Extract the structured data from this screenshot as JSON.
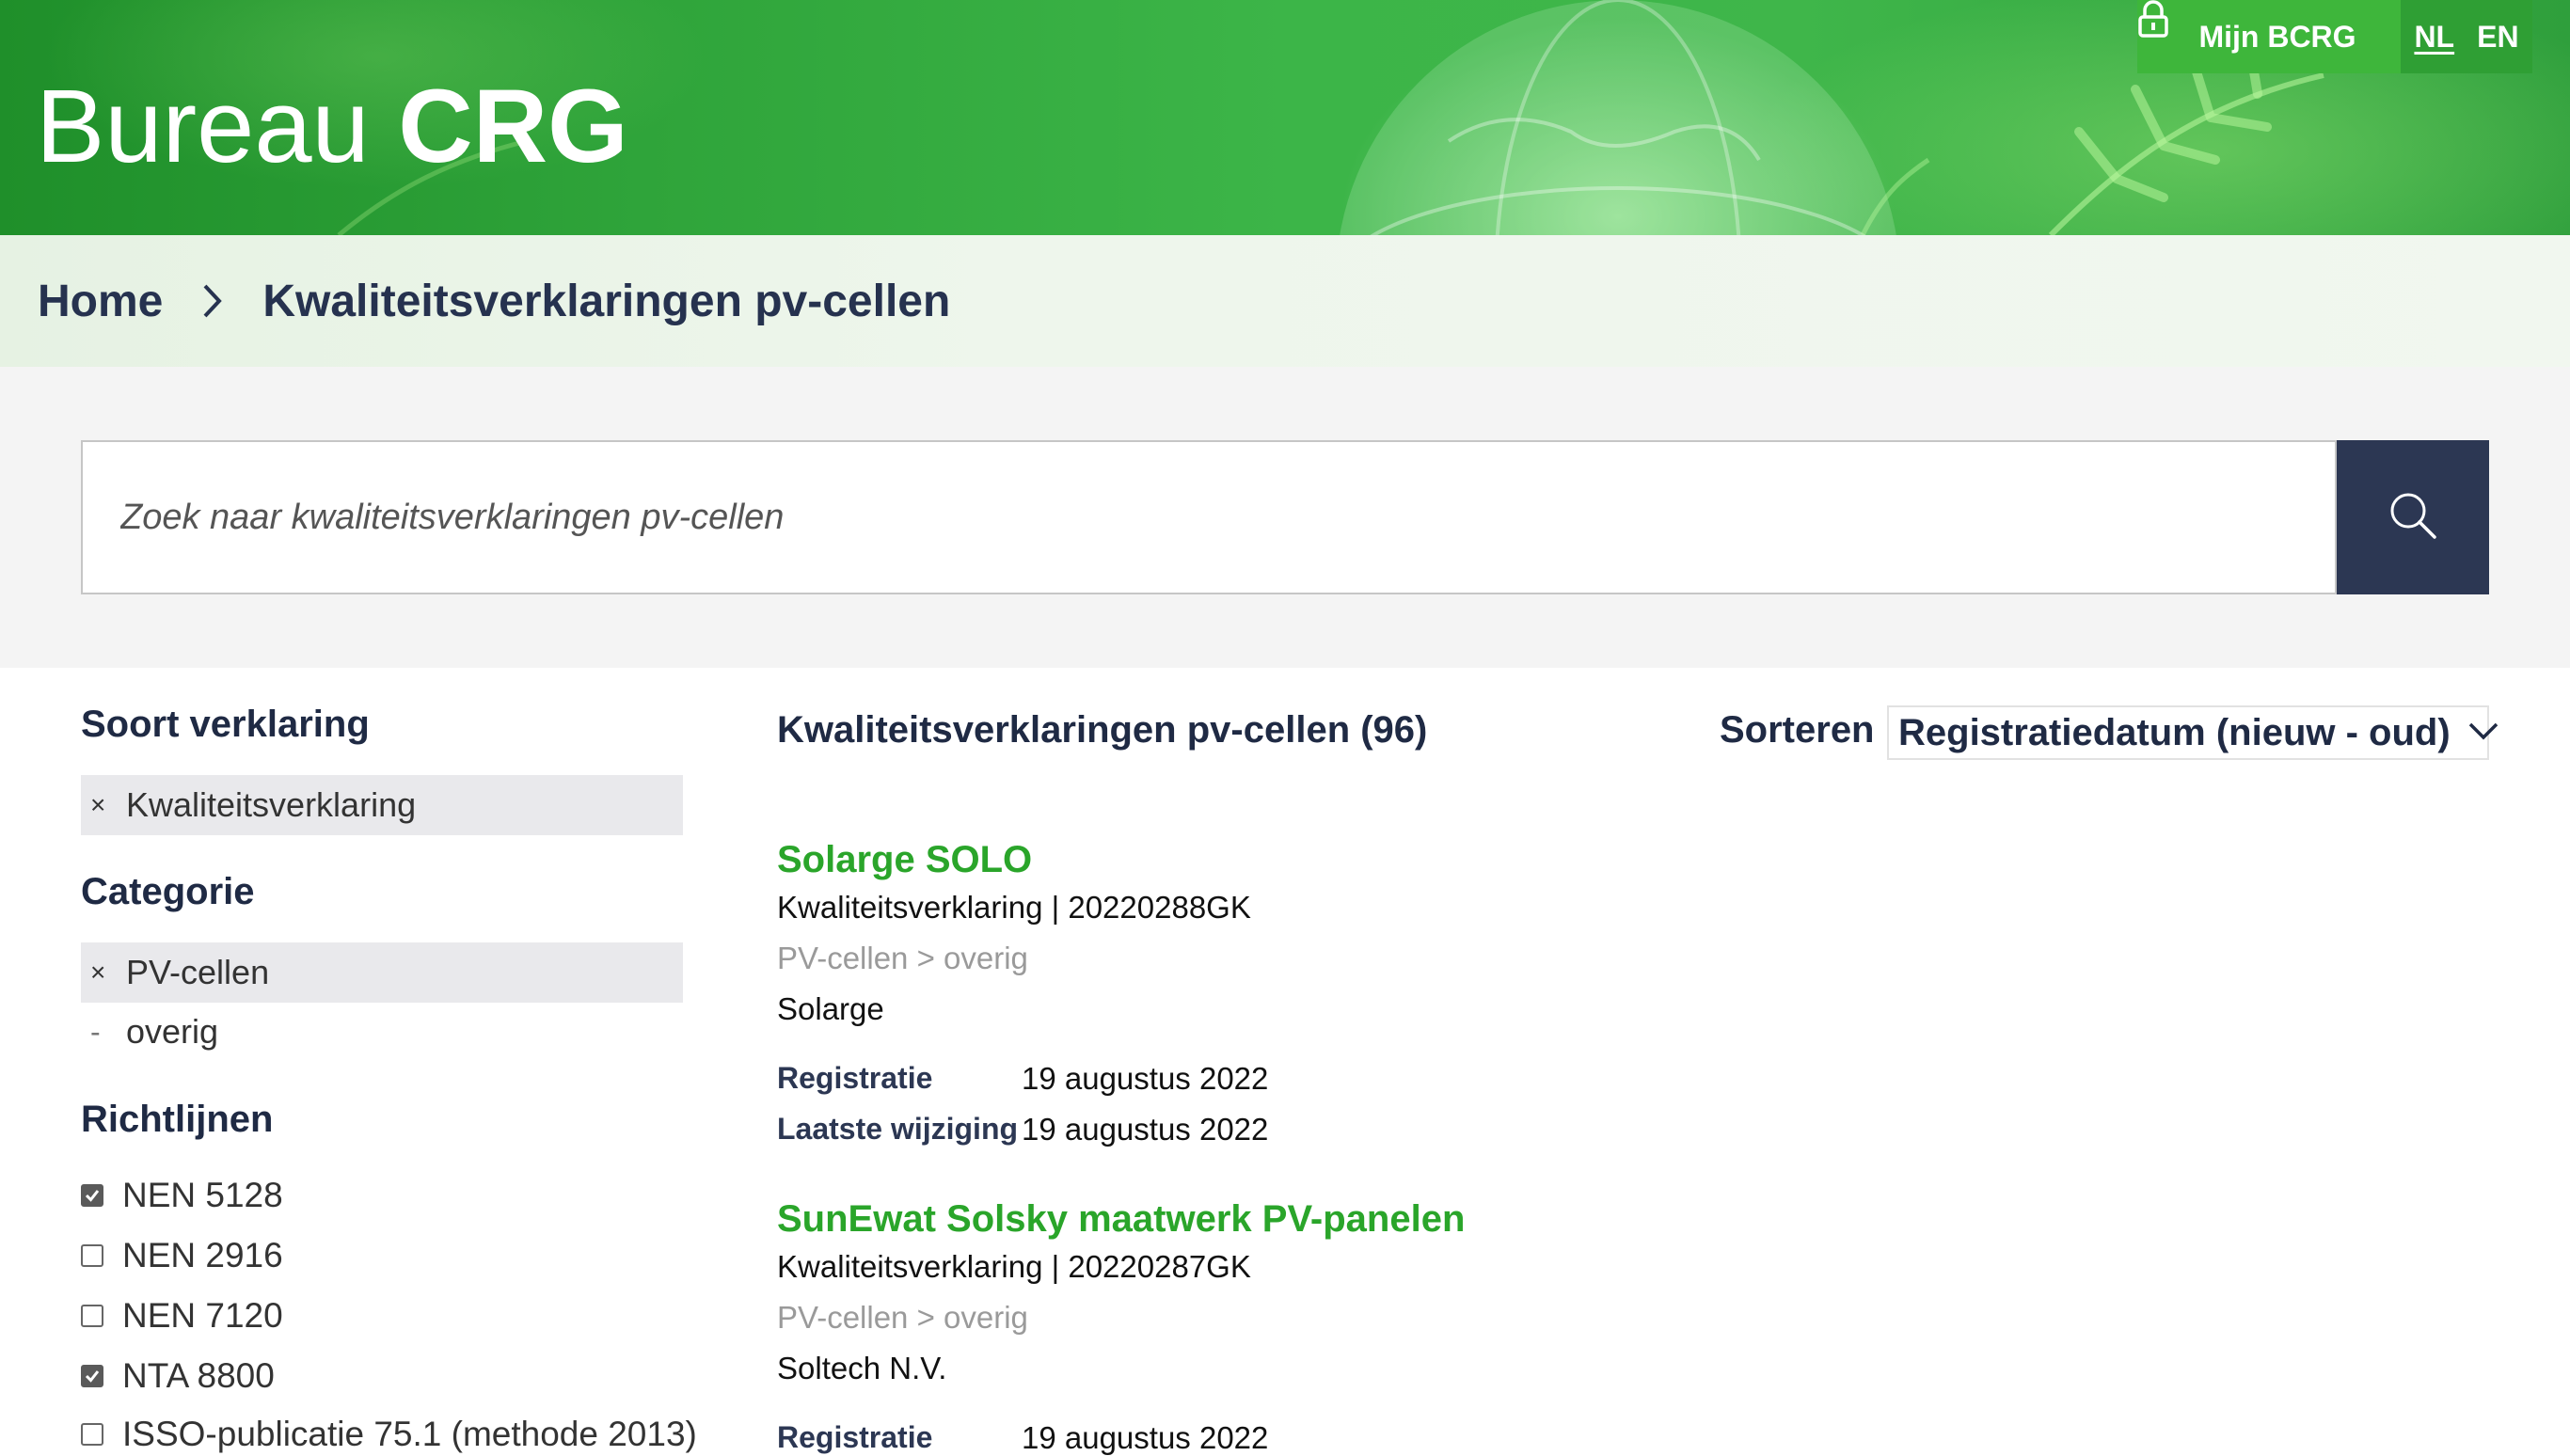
{
  "header": {
    "logo_light": "Bureau",
    "logo_bold": "CRG",
    "account_label": "Mijn BCRG",
    "languages": [
      "NL",
      "EN"
    ],
    "active_language": "NL",
    "icons": {
      "account": "lock-icon"
    }
  },
  "breadcrumb": {
    "home": "Home",
    "current": "Kwaliteitsverklaringen pv-cellen",
    "separator_icon": "chevron-right-icon"
  },
  "search": {
    "placeholder": "Zoek naar kwaliteitsverklaringen pv-cellen",
    "value": "",
    "icon": "search-icon"
  },
  "filters": {
    "soort": {
      "title": "Soort verklaring",
      "active": {
        "remove": "×",
        "label": "Kwaliteitsverklaring"
      }
    },
    "categorie": {
      "title": "Categorie",
      "active": {
        "remove": "×",
        "label": "PV-cellen"
      },
      "sub": {
        "marker": "-",
        "label": "overig"
      }
    },
    "richtlijnen": {
      "title": "Richtlijnen",
      "items": [
        {
          "label": "NEN 5128",
          "checked": true
        },
        {
          "label": "NEN 2916",
          "checked": false
        },
        {
          "label": "NEN 7120",
          "checked": false
        },
        {
          "label": "NTA 8800",
          "checked": true
        },
        {
          "label": "ISSO-publicatie 75.1 (methode 2013)",
          "checked": false
        }
      ]
    }
  },
  "results": {
    "title": "Kwaliteitsverklaringen pv-cellen (96)",
    "sort_label": "Sorteren",
    "sort_value": "Registratiedatum (nieuw - oud)",
    "registratie_label": "Registratie",
    "wijziging_label": "Laatste wijziging",
    "items": [
      {
        "title": "Solarge SOLO",
        "meta": "Kwaliteitsverklaring | 20220288GK",
        "category": "PV-cellen > overig",
        "company": "Solarge",
        "registratie": "19 augustus 2022",
        "wijziging": "19 augustus 2022"
      },
      {
        "title": "SunEwat Solsky maatwerk PV-panelen",
        "meta": "Kwaliteitsverklaring | 20220287GK",
        "category": "PV-cellen > overig",
        "company": "Soltech N.V.",
        "registratie": "19 augustus 2022",
        "wijziging": ""
      }
    ]
  },
  "colors": {
    "brand_green": "#2aa52a",
    "navy": "#2c3753",
    "account_green": "#3eb63b"
  }
}
